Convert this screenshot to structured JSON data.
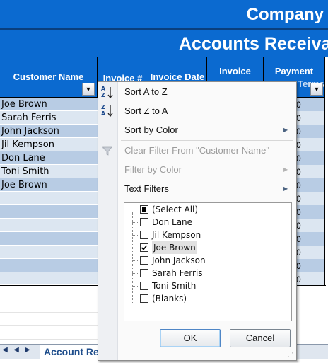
{
  "banner": {
    "title": "Company",
    "subtitle": "Accounts Receiva"
  },
  "headers": {
    "customer_name": "Customer Name",
    "invoice_no": "Invoice #",
    "invoice_date": "Invoice Date",
    "invoice_amount": "Invoice",
    "payment_terms": "Payment",
    "payment_terms_partial": "Terms"
  },
  "rows": [
    "Joe Brown",
    "Sarah Ferris",
    "John Jackson",
    "Jil Kempson",
    "Don Lane",
    "Toni Smith",
    "Joe Brown"
  ],
  "right_column_values": [
    "0",
    "0",
    "0",
    "0",
    "0",
    "0",
    "0",
    "0",
    "0",
    "0",
    "0",
    "0",
    "0",
    "0"
  ],
  "sheet": {
    "tab_label": "Account Re"
  },
  "menu": {
    "sort_az": "Sort A to Z",
    "sort_za": "Sort Z to A",
    "sort_by_color": "Sort by Color",
    "clear_filter": "Clear Filter From \"Customer Name\"",
    "filter_by_color": "Filter by Color",
    "text_filters": "Text Filters",
    "list": [
      {
        "label": "(Select All)",
        "state": "partial"
      },
      {
        "label": "Don Lane",
        "state": "unchecked"
      },
      {
        "label": "Jil Kempson",
        "state": "unchecked"
      },
      {
        "label": "Joe Brown",
        "state": "checked"
      },
      {
        "label": "John Jackson",
        "state": "unchecked"
      },
      {
        "label": "Sarah Ferris",
        "state": "unchecked"
      },
      {
        "label": "Toni Smith",
        "state": "unchecked"
      },
      {
        "label": "(Blanks)",
        "state": "unchecked"
      }
    ],
    "ok_label": "OK",
    "cancel_label": "Cancel"
  },
  "icons": {
    "sort_az": "sort-ascending-icon",
    "sort_za": "sort-descending-icon",
    "clear_filter": "clear-filter-icon",
    "dropdown": "dropdown-arrow-icon",
    "submenu": "submenu-arrow-icon"
  },
  "colors": {
    "header_blue": "#0b6ad0",
    "row_blue": "#b8cce4",
    "row_light": "#dce6f1"
  }
}
